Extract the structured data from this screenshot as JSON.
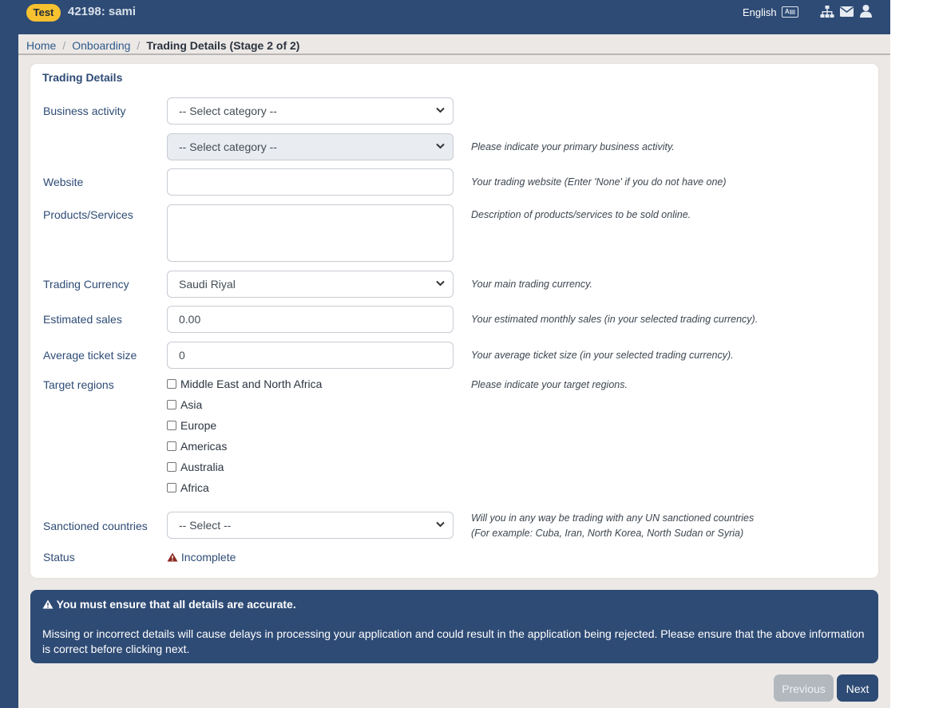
{
  "header": {
    "env_badge": "Test",
    "merchant_title": "42198: sami",
    "language_label": "English",
    "language_icon": "language-id-card-icon",
    "icons": [
      "sitemap-icon",
      "envelope-icon",
      "user-icon"
    ]
  },
  "breadcrumb": {
    "items": [
      "Home",
      "Onboarding"
    ],
    "current": "Trading Details (Stage 2 of 2)"
  },
  "form": {
    "title": "Trading Details",
    "business_activity": {
      "label": "Business activity",
      "select1_value": "-- Select category --",
      "select2_value": "-- Select category --",
      "hint": "Please indicate your primary business activity."
    },
    "website": {
      "label": "Website",
      "value": "",
      "hint": "Your trading website (Enter 'None' if you do not have one)"
    },
    "products": {
      "label": "Products/Services",
      "value": "",
      "hint": "Description of products/services to be sold online."
    },
    "currency": {
      "label": "Trading Currency",
      "value": "Saudi Riyal",
      "hint": "Your main trading currency."
    },
    "estimated_sales": {
      "label": "Estimated sales",
      "value": "0.00",
      "hint": "Your estimated monthly sales (in your selected trading currency)."
    },
    "ticket_size": {
      "label": "Average ticket size",
      "value": "0",
      "hint": "Your average ticket size (in your selected trading currency)."
    },
    "target_regions": {
      "label": "Target regions",
      "hint": "Please indicate your target regions.",
      "options": [
        "Middle East and North Africa",
        "Asia",
        "Europe",
        "Americas",
        "Australia",
        "Africa"
      ]
    },
    "sanctioned": {
      "label": "Sanctioned countries",
      "value": "-- Select --",
      "hint_line1": "Will you in any way be trading with any UN sanctioned countries",
      "hint_line2": "(For example: Cuba, Iran, North Korea, North Sudan or Syria)"
    },
    "status": {
      "label": "Status",
      "value": "Incomplete",
      "icon": "warning-icon"
    }
  },
  "alert": {
    "title": "You must ensure that all details are accurate.",
    "body": "Missing or incorrect details will cause delays in processing your application and could result in the application being rejected. Please ensure that the above information is correct before clicking next."
  },
  "buttons": {
    "previous": "Previous",
    "next": "Next"
  },
  "colors": {
    "brand": "#2e4b75",
    "badge": "#f7c12f",
    "background": "#ece8e5",
    "warning": "#a33a2a"
  }
}
